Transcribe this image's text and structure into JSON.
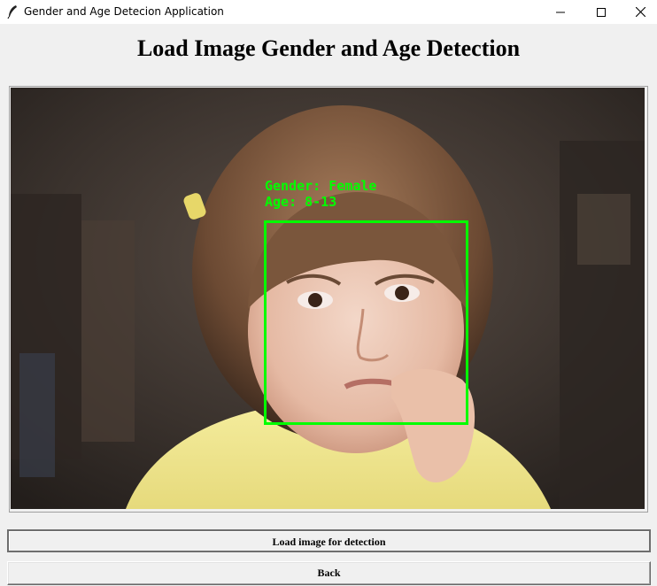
{
  "window": {
    "title": "Gender and Age Detecion Application",
    "icon": "feather-icon",
    "controls": [
      "minimize-icon",
      "maximize-icon",
      "close-icon"
    ]
  },
  "heading": "Load Image Gender and Age Detection",
  "detection": {
    "gender_label": "Gender: Female",
    "age_label": "Age: 8-13",
    "box_color": "#00ff00"
  },
  "buttons": {
    "load_label": "Load image for detection",
    "back_label": "Back"
  }
}
